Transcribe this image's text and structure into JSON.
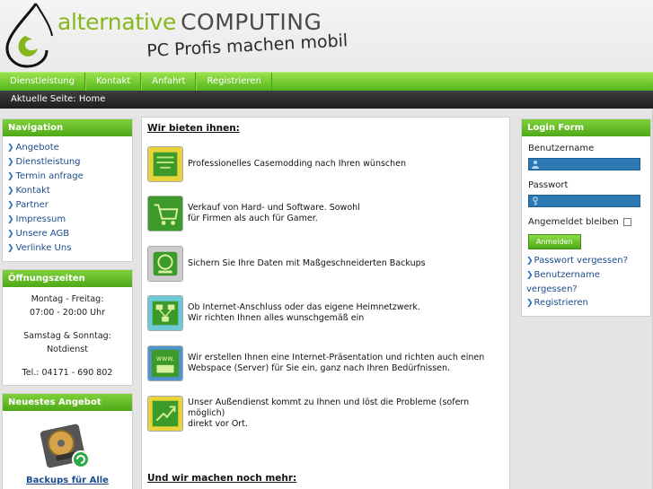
{
  "header": {
    "brand_alt": "alternative",
    "brand_comp": "COMPUTING",
    "tagline": "PC Profis machen mobil"
  },
  "nav": {
    "items": [
      "Dienstleistung",
      "Kontakt",
      "Anfahrt",
      "Registrieren"
    ]
  },
  "breadcrumb": "Aktuelle Seite: Home",
  "navigation_box": {
    "title": "Navigation",
    "items": [
      "Angebote",
      "Dienstleistung",
      "Termin anfrage",
      "Kontakt",
      "Partner",
      "Impressum",
      "Unsere AGB",
      "Verlinke Uns"
    ]
  },
  "hours_box": {
    "title": "Öffnungszeiten",
    "weekday_label": "Montag - Freitag:",
    "weekday_hours": "07:00 - 20:00 Uhr",
    "weekend_label": "Samstag & Sonntag:",
    "weekend_hours": "Notdienst",
    "phone": "Tel.: 04171 - 690 802"
  },
  "offer_box": {
    "title": "Neuestes Angebot",
    "link": "Backups für Alle",
    "image_icon": "hard-drive-backup-icon"
  },
  "main": {
    "heading": "Wir bieten ihnen:",
    "services": [
      {
        "icon": "case-modding-icon",
        "line1": "Professionelles Casemodding nach Ihren wünschen",
        "line2": ""
      },
      {
        "icon": "shopping-cart-icon",
        "line1": "Verkauf von Hard- und Software. Sowohl",
        "line2": "für Firmen als auch für Gamer."
      },
      {
        "icon": "backup-icon",
        "line1": "Sichern Sie Ihre Daten mit Maßgeschneiderten Backups",
        "line2": ""
      },
      {
        "icon": "network-icon",
        "line1": "Ob Internet-Anschluss oder das eigene Heimnetzwerk.",
        "line2": "Wir richten Ihnen alles wunschgemäß ein"
      },
      {
        "icon": "www-icon",
        "line1": "Wir erstellen Ihnen eine Internet-Präsentation und richten auch einen",
        "line2": "Webspace (Server) für Sie ein, ganz nach Ihren Bedürfnissen."
      },
      {
        "icon": "field-service-icon",
        "line1": "Unser Außendienst kommt zu Ihnen und löst die Probleme (sofern möglich)",
        "line2": "direkt vor Ort."
      }
    ],
    "heading2": "Und wir machen noch mehr:"
  },
  "login": {
    "title": "Login Form",
    "username_label": "Benutzername",
    "password_label": "Passwort",
    "remember_label": "Angemeldet bleiben",
    "submit": "Anmelden",
    "links": [
      "Passwort vergessen?",
      "Benutzername vergessen?",
      "Registrieren"
    ]
  },
  "colors": {
    "accent_green": "#5cb81f",
    "link_blue": "#1a4b8c",
    "input_blue": "#2d79b3",
    "dark_bar": "#2a2a2a"
  }
}
